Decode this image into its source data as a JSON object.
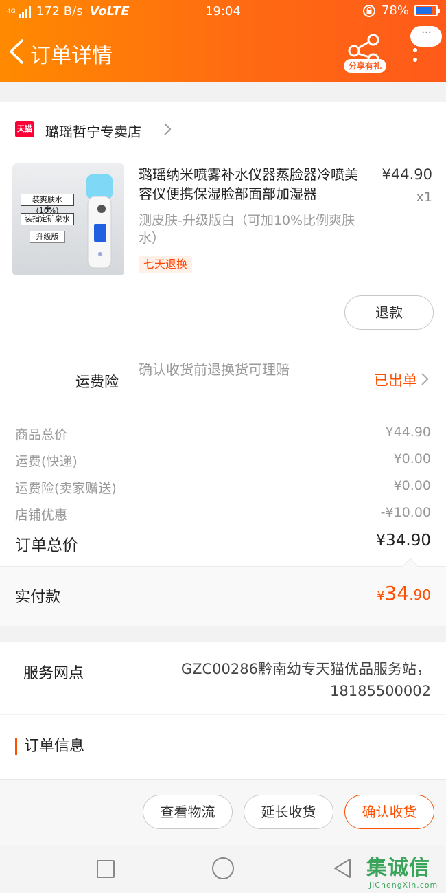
{
  "status_bar": {
    "network": "4G",
    "speed": "172 B/s",
    "volte": "VoLTE",
    "time": "19:04",
    "battery": "78%",
    "battery_level": 0.78
  },
  "header": {
    "title": "订单详情",
    "share_badge": "分享有礼",
    "more_bubble": "···"
  },
  "shop": {
    "platform_logo": "天猫",
    "name": "璐瑶哲宁专卖店"
  },
  "product": {
    "title": "璐瑶纳米喷雾补水仪器蒸脸器冷喷美容仪便携保湿脸部面部加湿器",
    "price": "¥44.90",
    "quantity": "x1",
    "sku": "测皮肤-升级版白（可加10%比例爽肤水）",
    "tag": "七天退换",
    "image_labels": {
      "line1": "装爽肤水(10%)",
      "plus": "+",
      "line2": "装指定矿泉水",
      "level": "升级版"
    },
    "refund_button": "退款"
  },
  "insurance": {
    "label": "运费险",
    "description": "确认收货前退换货可理赔",
    "status": "已出单"
  },
  "fees": [
    {
      "label": "商品总价",
      "value": "¥44.90"
    },
    {
      "label": "运费(快递)",
      "value": "¥0.00"
    },
    {
      "label": "运费险(卖家赠送)",
      "value": "¥0.00"
    },
    {
      "label": "店铺优惠",
      "value": "-¥10.00"
    }
  ],
  "order_total": {
    "label": "订单总价",
    "value": "¥34.90"
  },
  "paid": {
    "label": "实付款",
    "currency": "¥",
    "integer": "34",
    "decimal": ".90"
  },
  "service": {
    "label": "服务网点",
    "value": "GZC00286黔南幼专天猫优品服务站，18185500002"
  },
  "order_info": {
    "title": "订单信息"
  },
  "actions": {
    "logistics": "查看物流",
    "extend": "延长收货",
    "confirm": "确认收货"
  },
  "watermark": {
    "text": "集诚信",
    "url": "JiChengXin.com"
  },
  "colors": {
    "header_orange": "#ff6a12",
    "accent": "#ff5000",
    "tmall_red": "#ff0036"
  }
}
